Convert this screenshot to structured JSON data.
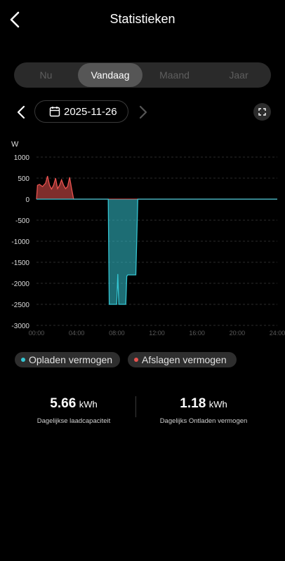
{
  "header": {
    "title": "Statistieken",
    "back_icon": "chevron-left-icon"
  },
  "tabs": [
    {
      "label": "Nu",
      "active": false
    },
    {
      "label": "Vandaag",
      "active": true
    },
    {
      "label": "Maand",
      "active": false
    },
    {
      "label": "Jaar",
      "active": false
    }
  ],
  "date_nav": {
    "date": "2025-11-26",
    "prev_icon": "chevron-left-icon",
    "next_icon": "chevron-right-icon",
    "calendar_icon": "calendar-icon",
    "expand_icon": "expand-icon"
  },
  "legend": [
    {
      "label": "Opladen vermogen",
      "color": "#35c6d3"
    },
    {
      "label": "Afslagen vermogen",
      "color": "#e8524f"
    }
  ],
  "stats": {
    "charge": {
      "value": "5.66",
      "unit": "kWh",
      "caption": "Dagelijkse laadcapaciteit"
    },
    "discharge": {
      "value": "1.18",
      "unit": "kWh",
      "caption": "Dagelijks Ontladen vermogen"
    }
  },
  "chart_data": {
    "type": "area",
    "unit_label": "W",
    "ylim": [
      -3000,
      1000
    ],
    "yticks": [
      1000,
      500,
      0,
      -500,
      -1000,
      -1500,
      -2000,
      -2500,
      -3000
    ],
    "xlim": [
      0,
      24
    ],
    "xticks": [
      "00:00",
      "04:00",
      "08:00",
      "12:00",
      "16:00",
      "20:00",
      "24:00"
    ],
    "grid": true,
    "series": [
      {
        "name": "Afslagen vermogen",
        "color": "#e8524f",
        "x": [
          0.0,
          0.1,
          0.3,
          0.6,
          0.9,
          1.1,
          1.3,
          1.5,
          1.7,
          1.9,
          2.1,
          2.3,
          2.5,
          2.7,
          2.9,
          3.1,
          3.3,
          3.5,
          3.7,
          24.0
        ],
        "values": [
          0,
          330,
          350,
          300,
          380,
          550,
          330,
          240,
          330,
          500,
          250,
          330,
          460,
          330,
          250,
          300,
          520,
          250,
          0,
          0
        ]
      },
      {
        "name": "Opladen vermogen",
        "color": "#35c6d3",
        "x": [
          0.0,
          7.15,
          7.25,
          7.4,
          8.0,
          8.1,
          8.2,
          8.9,
          9.0,
          9.1,
          9.9,
          10.1,
          10.2,
          24.0
        ],
        "values": [
          0,
          0,
          -2500,
          -2500,
          -2500,
          -1780,
          -2500,
          -2500,
          -1830,
          -1800,
          -1800,
          0,
          0,
          0
        ]
      }
    ]
  }
}
